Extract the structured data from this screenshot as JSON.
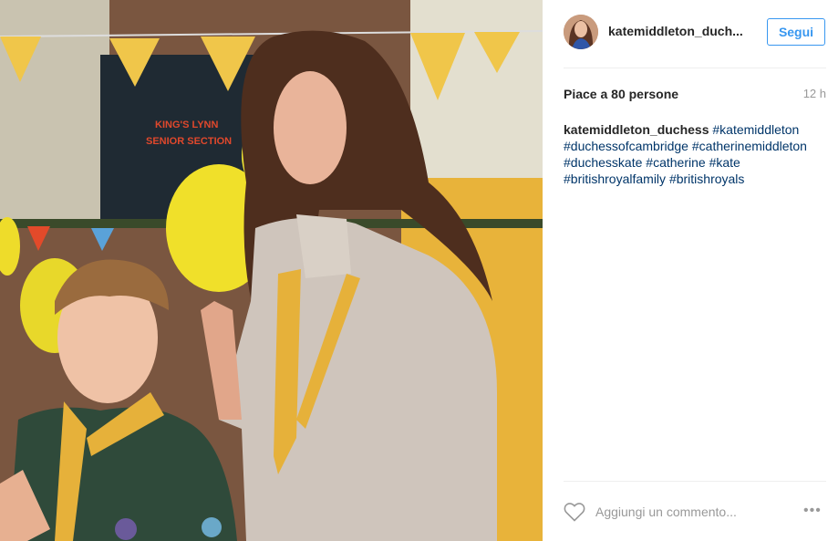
{
  "post": {
    "username": "katemiddleton_duch...",
    "follow_label": "Segui",
    "likes_text": "Piace a 80 persone",
    "time_text": "12 h",
    "caption_author": "katemiddleton_duchess",
    "hashtags": [
      "#katemiddleton",
      "#duchessofcambridge",
      "#catherinemiddleton",
      "#duchesskate",
      "#catherine",
      "#kate",
      "#britishroyalfamily",
      "#britishroyals"
    ],
    "comment_placeholder": "Aggiungi un commento...",
    "more_label": "•••"
  },
  "icons": {
    "heart": "heart-icon",
    "more": "more-options-icon"
  },
  "colors": {
    "accent": "#3897f0",
    "hashtag": "#003569"
  }
}
